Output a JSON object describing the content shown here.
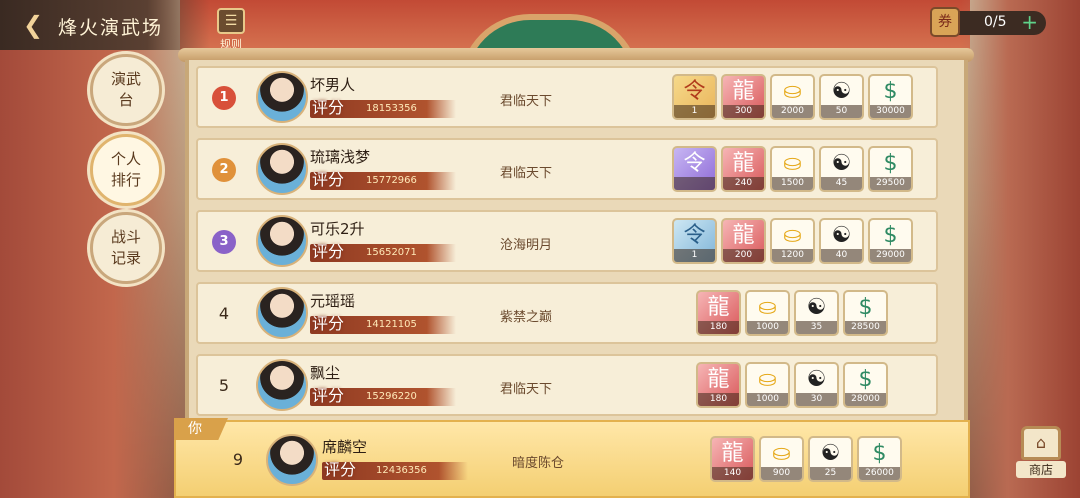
{
  "header": {
    "title": "烽火演武场",
    "rules_label": "规则"
  },
  "counter": {
    "value": "0/5",
    "plus": "+"
  },
  "tabs": [
    {
      "label": "演武台"
    },
    {
      "label": "个人排行"
    },
    {
      "label": "战斗记录"
    }
  ],
  "score_label": "评分",
  "rows": [
    {
      "rank": "1",
      "name": "坏男人",
      "score": "18153356",
      "title": "君临天下",
      "rewards": [
        {
          "type": "token",
          "glyph": "令",
          "count": "1"
        },
        {
          "type": "dragon",
          "glyph": "龍",
          "count": "300"
        },
        {
          "type": "gold",
          "glyph": "⛀",
          "count": "2000"
        },
        {
          "type": "book",
          "glyph": "☯",
          "count": "50"
        },
        {
          "type": "jade",
          "glyph": "$",
          "count": "30000"
        }
      ]
    },
    {
      "rank": "2",
      "name": "琉璃浅梦",
      "score": "15772966",
      "title": "君临天下",
      "rewards": [
        {
          "type": "token-purple",
          "glyph": "令",
          "count": ""
        },
        {
          "type": "dragon",
          "glyph": "龍",
          "count": "240"
        },
        {
          "type": "gold",
          "glyph": "⛀",
          "count": "1500"
        },
        {
          "type": "book",
          "glyph": "☯",
          "count": "45"
        },
        {
          "type": "jade",
          "glyph": "$",
          "count": "29500"
        }
      ]
    },
    {
      "rank": "3",
      "name": "可乐2升",
      "score": "15652071",
      "title": "沧海明月",
      "rewards": [
        {
          "type": "token-blue",
          "glyph": "令",
          "count": "1"
        },
        {
          "type": "dragon",
          "glyph": "龍",
          "count": "200"
        },
        {
          "type": "gold",
          "glyph": "⛀",
          "count": "1200"
        },
        {
          "type": "book",
          "glyph": "☯",
          "count": "40"
        },
        {
          "type": "jade",
          "glyph": "$",
          "count": "29000"
        }
      ]
    },
    {
      "rank": "4",
      "name": "元瑶瑶",
      "score": "14121105",
      "title": "紫禁之巅",
      "rewards": [
        {
          "type": "dragon",
          "glyph": "龍",
          "count": "180"
        },
        {
          "type": "gold",
          "glyph": "⛀",
          "count": "1000"
        },
        {
          "type": "book",
          "glyph": "☯",
          "count": "35"
        },
        {
          "type": "jade",
          "glyph": "$",
          "count": "28500"
        }
      ]
    },
    {
      "rank": "5",
      "name": "飘尘",
      "score": "15296220",
      "title": "君临天下",
      "rewards": [
        {
          "type": "dragon",
          "glyph": "龍",
          "count": "180"
        },
        {
          "type": "gold",
          "glyph": "⛀",
          "count": "1000"
        },
        {
          "type": "book",
          "glyph": "☯",
          "count": "30"
        },
        {
          "type": "jade",
          "glyph": "$",
          "count": "28000"
        }
      ]
    }
  ],
  "you": {
    "tag": "你",
    "rank": "9",
    "name": "席麟空",
    "score": "12436356",
    "title": "暗度陈仓",
    "rewards": [
      {
        "type": "dragon",
        "glyph": "龍",
        "count": "140"
      },
      {
        "type": "gold",
        "glyph": "⛀",
        "count": "900"
      },
      {
        "type": "book",
        "glyph": "☯",
        "count": "25"
      },
      {
        "type": "jade",
        "glyph": "$",
        "count": "26000"
      }
    ]
  },
  "shop_label": "商店",
  "colors": {
    "rank1": "#d8503a",
    "rank2": "#e0913a",
    "rank3": "#8a62c8"
  }
}
